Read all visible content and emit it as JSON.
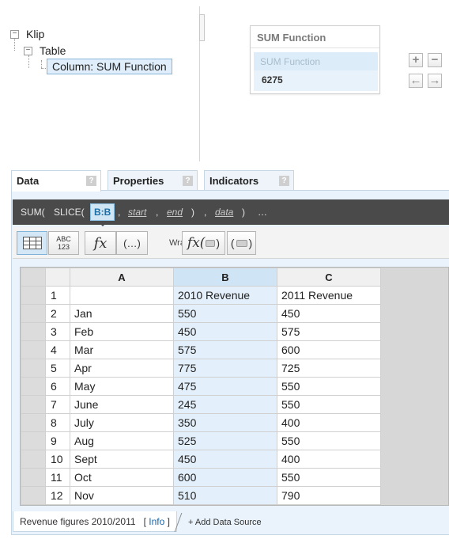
{
  "tree": {
    "root": "Klip",
    "child": "Table",
    "leaf": "Column: SUM Function"
  },
  "preview": {
    "title": "SUM Function",
    "label": "SUM Function",
    "value": "6275"
  },
  "controls": {
    "add": "+",
    "remove": "−",
    "left": "←",
    "right": "→"
  },
  "tabs": [
    {
      "label": "Data",
      "help": "?"
    },
    {
      "label": "Properties",
      "help": "?"
    },
    {
      "label": "Indicators",
      "help": "?"
    }
  ],
  "formula": {
    "sum": "SUM(",
    "slice": "SLICE(",
    "ref": "B:B",
    "comma": ",",
    "start": "start",
    "end": "end",
    "close1": ")",
    "data": "data",
    "close2": ")",
    "more": "…"
  },
  "toolbar": {
    "abc": "ABC",
    "num": "123",
    "fx": "fx",
    "paren": "(…)",
    "wrap": "Wrap",
    "fx_wrap": "fx(",
    "fx_wrap_close": ")",
    "paren_wrap_open": "(",
    "paren_wrap_close": ")"
  },
  "grid": {
    "columns": [
      "A",
      "B",
      "C"
    ],
    "rows": [
      [
        "1",
        "",
        "2010 Revenue",
        "2011 Revenue"
      ],
      [
        "2",
        "Jan",
        "550",
        "450"
      ],
      [
        "3",
        "Feb",
        "450",
        "575"
      ],
      [
        "4",
        "Mar",
        "575",
        "600"
      ],
      [
        "5",
        "Apr",
        "775",
        "725"
      ],
      [
        "6",
        "May",
        "475",
        "550"
      ],
      [
        "7",
        "June",
        "245",
        "550"
      ],
      [
        "8",
        "July",
        "350",
        "400"
      ],
      [
        "9",
        "Aug",
        "525",
        "550"
      ],
      [
        "10",
        "Sept",
        "450",
        "400"
      ],
      [
        "11",
        "Oct",
        "600",
        "550"
      ],
      [
        "12",
        "Nov",
        "510",
        "790"
      ]
    ]
  },
  "datasource": {
    "name": "Revenue figures 2010/2011",
    "info_open": "[",
    "info": "Info",
    "info_close": "]",
    "add": "+ Add Data Source"
  },
  "colors": {
    "accent": "#1b6fa8",
    "selection": "#dfeefa",
    "formula_bg": "#4a4a4a"
  },
  "icons": [
    "tree-collapse-icon",
    "grid-view-icon",
    "function-icon",
    "plus-icon",
    "minus-icon",
    "arrow-left-icon",
    "arrow-right-icon",
    "help-icon"
  ]
}
